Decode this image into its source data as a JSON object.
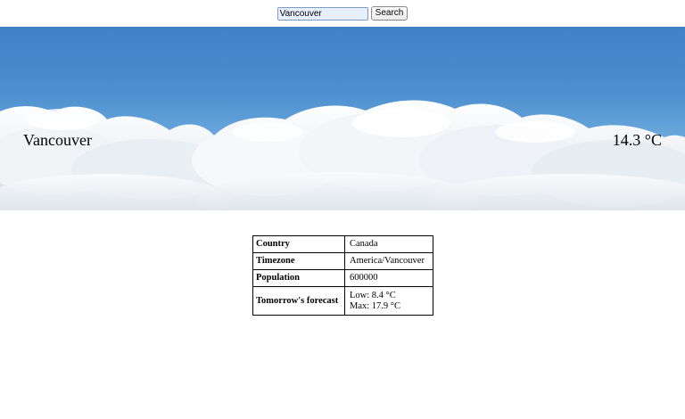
{
  "search": {
    "value": "Vancouver",
    "button_label": "Search"
  },
  "hero": {
    "city": "Vancouver",
    "temperature": "14.3 °C"
  },
  "info": {
    "rows": [
      {
        "label": "Country",
        "value": "Canada"
      },
      {
        "label": "Timezone",
        "value": "America/Vancouver"
      },
      {
        "label": "Population",
        "value": "600000"
      },
      {
        "label": "Tomorrow's forecast",
        "low": "Low: 8.4 °C",
        "max": "Max: 17.9 °C"
      }
    ]
  },
  "colors": {
    "sky_top": "#3f82c6",
    "cloud": "#f4f6f9"
  }
}
